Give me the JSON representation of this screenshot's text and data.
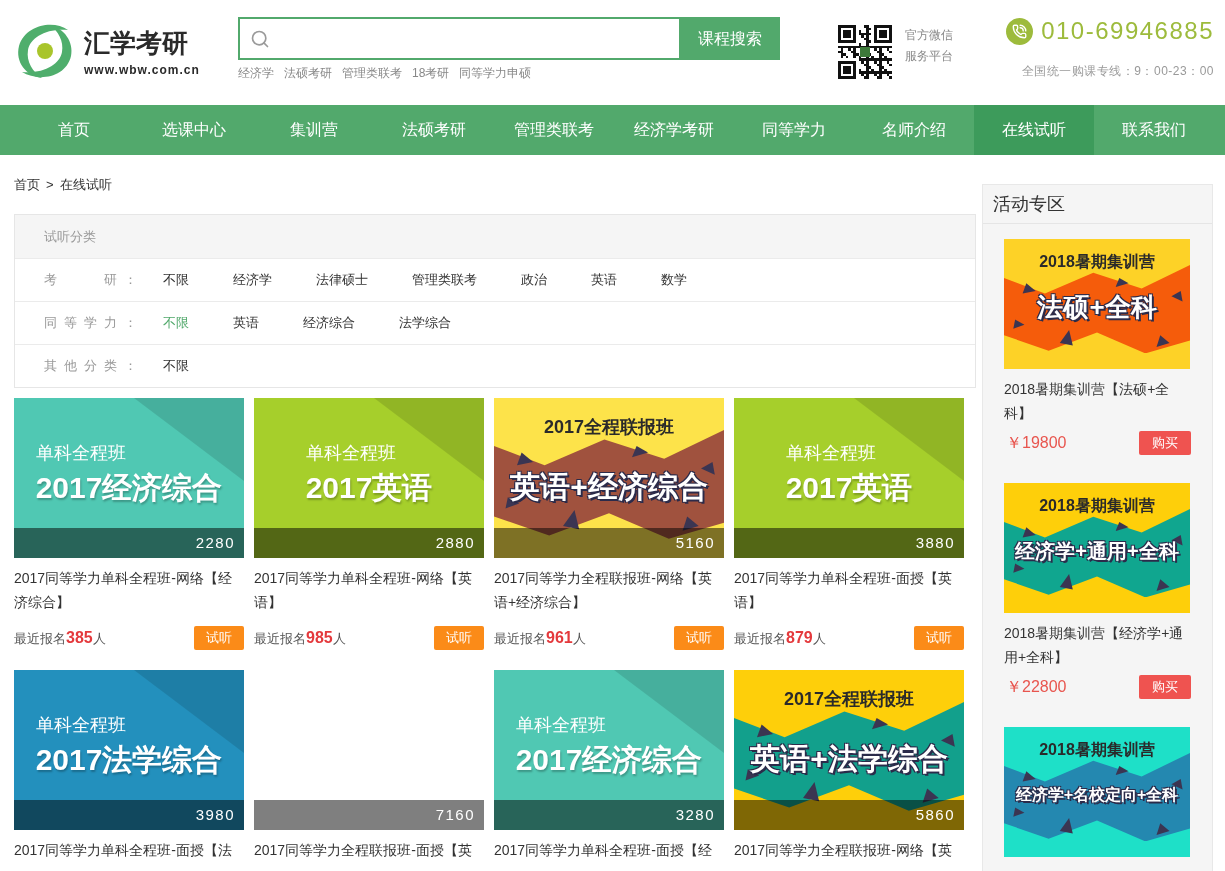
{
  "header": {
    "logo": {
      "name": "汇学考研",
      "url": "www.wbw.com.cn"
    },
    "search": {
      "button": "课程搜索",
      "hot_words": [
        "经济学",
        "法硕考研",
        "管理类联考",
        "18考研",
        "同等学力申硕"
      ]
    },
    "wechat": {
      "lines": [
        "官方微信",
        "服务平台"
      ]
    },
    "hotline": {
      "phone": "010-69946885",
      "hours": "全国统一购课专线：9：00-23：00"
    }
  },
  "nav": [
    {
      "label": "首页",
      "selected": false
    },
    {
      "label": "选课中心",
      "selected": false
    },
    {
      "label": "集训营",
      "selected": false
    },
    {
      "label": "法硕考研",
      "selected": false
    },
    {
      "label": "管理类联考",
      "selected": false
    },
    {
      "label": "经济学考研",
      "selected": false
    },
    {
      "label": "同等学力",
      "selected": false
    },
    {
      "label": "名师介绍",
      "selected": false
    },
    {
      "label": "在线试听",
      "selected": true
    },
    {
      "label": "联系我们",
      "selected": false
    }
  ],
  "breadcrumb": {
    "items": [
      "首页",
      "在线试听"
    ],
    "separator": ">"
  },
  "filters": {
    "title": "试听分类",
    "groups": [
      {
        "label": "考　　研：",
        "options": [
          {
            "label": "不限",
            "selected": false
          },
          {
            "label": "经济学",
            "selected": false
          },
          {
            "label": "法律硕士",
            "selected": false
          },
          {
            "label": "管理类联考",
            "selected": false
          },
          {
            "label": "政治",
            "selected": false
          },
          {
            "label": "英语",
            "selected": false
          },
          {
            "label": "数学",
            "selected": false
          }
        ]
      },
      {
        "label": "同等学力：",
        "options": [
          {
            "label": "不限",
            "selected": true
          },
          {
            "label": "英语",
            "selected": false
          },
          {
            "label": "经济综合",
            "selected": false
          },
          {
            "label": "法学综合",
            "selected": false
          }
        ]
      },
      {
        "label": "其他分类：",
        "options": [
          {
            "label": "不限",
            "selected": false
          }
        ]
      }
    ]
  },
  "courses": [
    {
      "thumb": {
        "kind": "single",
        "color": "#50c8b3",
        "subtitle": "单科全程班",
        "title": "2017经济综合"
      },
      "price": "2280",
      "title": "2017同等学力单科全程班-网络【经济综合】",
      "enroll": "最近报名**385**人",
      "button": "试听"
    },
    {
      "thumb": {
        "kind": "single",
        "color": "#a6cf2b",
        "subtitle": "单科全程班",
        "title": "2017英语"
      },
      "price": "2880",
      "title": "2017同等学力单科全程班-网络【英语】",
      "enroll": "最近报名**985**人",
      "button": "试听"
    },
    {
      "thumb": {
        "kind": "combo",
        "color": "#fde34a",
        "band": {
          "color": "#a0523e"
        },
        "heading": "2017全程联报班",
        "title": "英语+经济综合"
      },
      "price": "5160",
      "title": "2017同等学力全程联报班-网络【英语+经济综合】",
      "enroll": "最近报名**961**人",
      "button": "试听"
    },
    {
      "thumb": {
        "kind": "single",
        "color": "#a6cf2b",
        "subtitle": "单科全程班",
        "title": "2017英语"
      },
      "price": "3880",
      "title": "2017同等学力单科全程班-面授【英语】",
      "enroll": "最近报名**879**人",
      "button": "试听"
    },
    {
      "thumb": {
        "kind": "single",
        "color": "#2390bd",
        "subtitle": "单科全程班",
        "title": "2017法学综合"
      },
      "price": "3980",
      "title": "2017同等学力单科全程班-面授【法"
    },
    {
      "thumb": {
        "kind": "blank"
      },
      "price": "7160",
      "title": "2017同等学力全程联报班-面授【英"
    },
    {
      "thumb": {
        "kind": "single",
        "color": "#50c8b3",
        "subtitle": "单科全程班",
        "title": "2017经济综合"
      },
      "price": "3280",
      "title": "2017同等学力单科全程班-面授【经"
    },
    {
      "thumb": {
        "kind": "combo",
        "color": "#fecf0a",
        "band": {
          "color": "#12a08c"
        },
        "heading": "2017全程联报班",
        "title": "英语+法学综合"
      },
      "price": "5860",
      "title": "2017同等学力全程联报班-网络【英"
    }
  ],
  "sidebar": {
    "title": "活动专区",
    "items": [
      {
        "thumb": {
          "kind": "combo",
          "color": "#fdd227",
          "band": {
            "color": "#f55c0b"
          },
          "heading": "2018暑期集训营",
          "title": "法硕+全科"
        },
        "title": "2018暑期集训营【法硕+全科】",
        "price": "￥19800",
        "button": "购买"
      },
      {
        "thumb": {
          "kind": "combo",
          "color": "#fecf0a",
          "band": {
            "color": "#10a68f"
          },
          "heading": "2018暑期集训营",
          "title": "经济学+通用+全科"
        },
        "title": "2018暑期集训营【经济学+通用+全科】",
        "price": "￥22800",
        "button": "购买"
      },
      {
        "thumb": {
          "kind": "combo",
          "color": "#1ee0c8",
          "band": {
            "color": "#2488b0"
          },
          "heading": "2018暑期集训营",
          "title": "经济学+名校定向+全科"
        }
      }
    ]
  }
}
